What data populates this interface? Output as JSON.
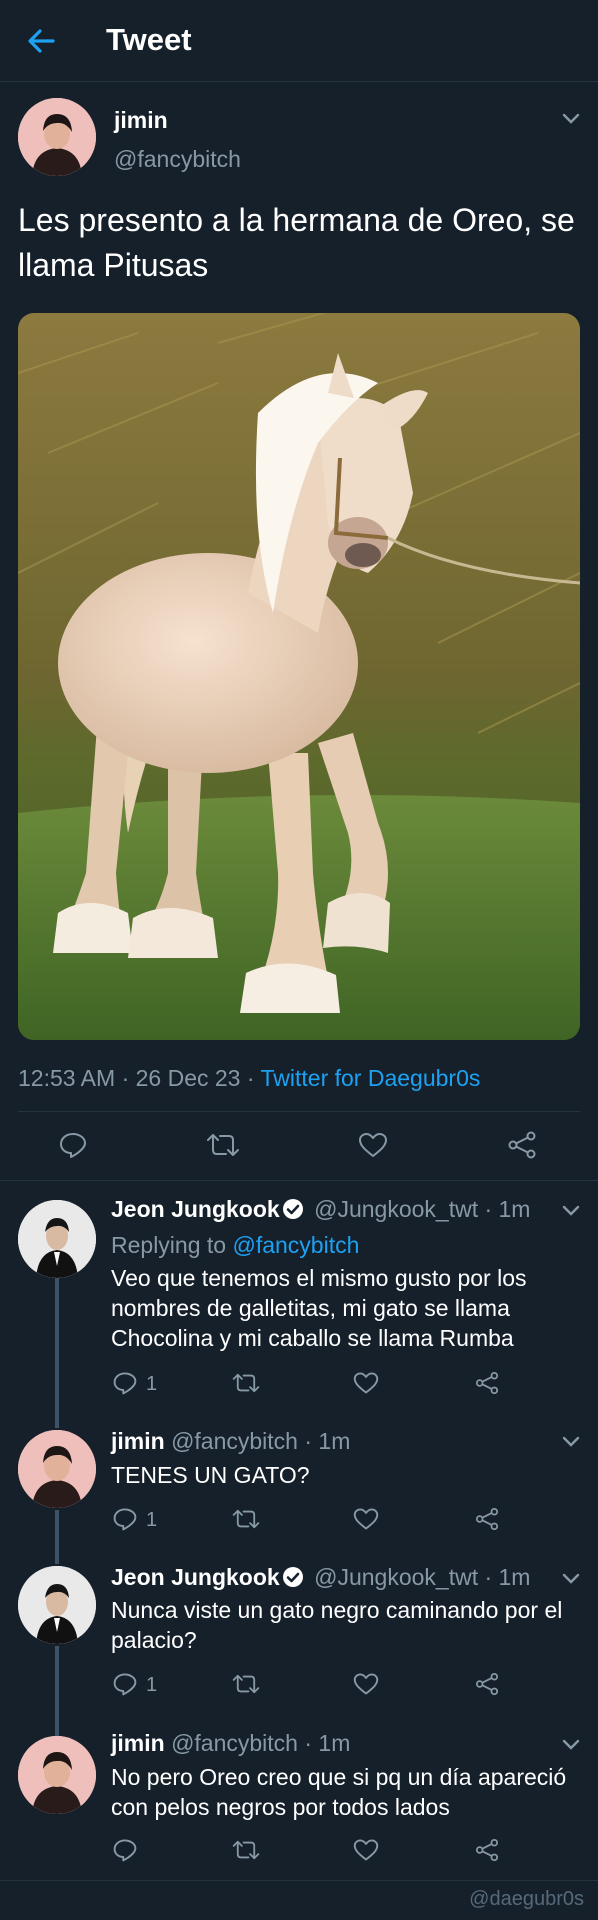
{
  "header": {
    "title": "Tweet",
    "back_icon": "arrow-left-icon",
    "accent": "#1da1f2"
  },
  "main_tweet": {
    "name": "jimin",
    "handle": "@fancybitch",
    "text": "Les presento a la hermana de Oreo, se llama Pitusas",
    "time": "12:53 AM · 26 Dec 23 · ",
    "client": "Twitter for Daegubr0s"
  },
  "replies": [
    {
      "name": "Jeon Jungkook",
      "verified": true,
      "handle": "@Jungkook_twt · 1m",
      "replying_prefix": "Replying to ",
      "replying_to": "@fancybitch",
      "text": "Veo que tenemos el mismo gusto por los nombres de galletitas, mi gato se llama Chocolina y mi caballo se llama Rumba",
      "reply_count": "1"
    },
    {
      "name": "jimin",
      "verified": false,
      "handle": "@fancybitch · 1m",
      "text": "TENES UN GATO?",
      "reply_count": "1"
    },
    {
      "name": "Jeon Jungkook",
      "verified": true,
      "handle": "@Jungkook_twt · 1m",
      "text": "Nunca viste un gato negro caminando por el palacio?",
      "reply_count": "1"
    },
    {
      "name": "jimin",
      "verified": false,
      "handle": "@fancybitch · 1m",
      "text": "No pero Oreo creo que si pq un día apareció con pelos negros por todos lados",
      "reply_count": ""
    }
  ],
  "watermark": "@daegubr0s",
  "colors": {
    "background": "#15202b",
    "muted": "#8899a6",
    "link": "#1da1f2",
    "divider": "#253341"
  }
}
